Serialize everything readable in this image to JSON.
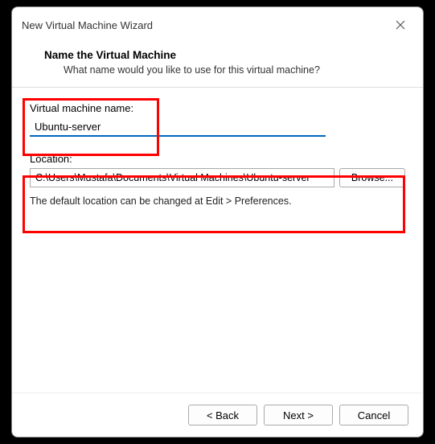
{
  "window": {
    "title": "New Virtual Machine Wizard"
  },
  "header": {
    "title": "Name the Virtual Machine",
    "subtitle": "What name would you like to use for this virtual machine?"
  },
  "fields": {
    "vm_name_label": "Virtual machine name:",
    "vm_name_value": "Ubuntu-server",
    "location_label": "Location:",
    "location_value": "C:\\Users\\Mustafa\\Documents\\Virtual Machines\\Ubuntu-server",
    "browse_label": "Browse...",
    "hint": "The default location can be changed at Edit > Preferences."
  },
  "footer": {
    "back": "< Back",
    "next": "Next >",
    "cancel": "Cancel"
  }
}
